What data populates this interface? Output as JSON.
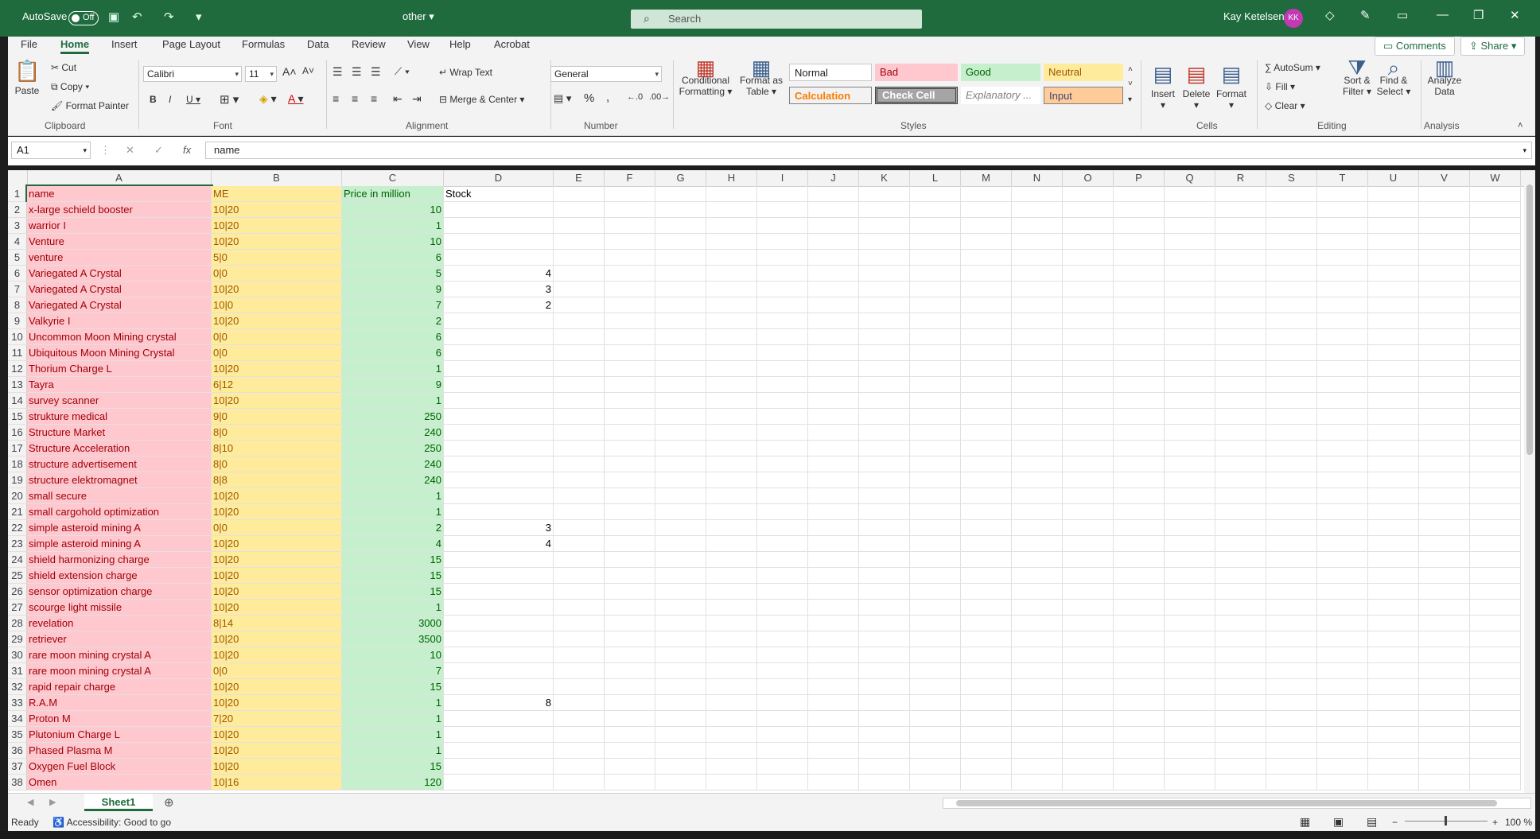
{
  "titlebar": {
    "autosave_label": "AutoSave",
    "autosave_state": "Off",
    "doc_title": "other",
    "search_placeholder": "Search",
    "user_name": "Kay Ketelsen",
    "user_initials": "KK"
  },
  "ribbon_tabs": [
    "File",
    "Home",
    "Insert",
    "Page Layout",
    "Formulas",
    "Data",
    "Review",
    "View",
    "Help",
    "Acrobat"
  ],
  "ribbon_buttons": {
    "comments": "Comments",
    "share": "Share"
  },
  "clipboard": {
    "paste": "Paste",
    "cut": "Cut",
    "copy": "Copy",
    "format_painter": "Format Painter",
    "group": "Clipboard"
  },
  "font": {
    "name": "Calibri",
    "size": "11",
    "group": "Font"
  },
  "alignment": {
    "wrap_text": "Wrap Text",
    "merge_center": "Merge & Center",
    "group": "Alignment"
  },
  "number": {
    "format": "General",
    "group": "Number"
  },
  "styles": {
    "conditional": "Conditional Formatting",
    "format_as_table": "Format as Table",
    "normal": "Normal",
    "bad": "Bad",
    "good": "Good",
    "neutral": "Neutral",
    "calculation": "Calculation",
    "check_cell": "Check Cell",
    "explanatory": "Explanatory ...",
    "input": "Input",
    "group": "Styles"
  },
  "cells": {
    "insert": "Insert",
    "delete": "Delete",
    "format": "Format",
    "group": "Cells"
  },
  "editing": {
    "autosum": "AutoSum",
    "fill": "Fill",
    "clear": "Clear",
    "sort_filter": "Sort & Filter",
    "find_select": "Find & Select",
    "group": "Editing"
  },
  "analysis": {
    "analyze_data": "Analyze Data",
    "group": "Analysis"
  },
  "formula_bar": {
    "name_box": "A1",
    "content": "name"
  },
  "columns": [
    "A",
    "B",
    "C",
    "D",
    "E",
    "F",
    "G",
    "H",
    "I",
    "J",
    "K",
    "L",
    "M",
    "N",
    "O",
    "P",
    "Q",
    "R",
    "S",
    "T",
    "U",
    "V",
    "W"
  ],
  "sheet_rows": [
    [
      "name",
      "ME",
      "Price in million",
      "Stock"
    ],
    [
      "x-large schield booster",
      "10|20",
      "10",
      ""
    ],
    [
      "warrior I",
      "10|20",
      "1",
      ""
    ],
    [
      "Venture",
      "10|20",
      "10",
      ""
    ],
    [
      "venture",
      "5|0",
      "6",
      ""
    ],
    [
      "Variegated A Crystal",
      "0|0",
      "5",
      "4"
    ],
    [
      "Variegated A Crystal",
      "10|20",
      "9",
      "3"
    ],
    [
      "Variegated A Crystal",
      "10|0",
      "7",
      "2"
    ],
    [
      "Valkyrie I",
      "10|20",
      "2",
      ""
    ],
    [
      "Uncommon Moon Mining crystal",
      "0|0",
      "6",
      ""
    ],
    [
      "Ubiquitous Moon Mining Crystal",
      "0|0",
      "6",
      ""
    ],
    [
      "Thorium Charge L",
      "10|20",
      "1",
      ""
    ],
    [
      "Tayra",
      "6|12",
      "9",
      ""
    ],
    [
      "survey scanner",
      "10|20",
      "1",
      ""
    ],
    [
      "strukture medical",
      "9|0",
      "250",
      ""
    ],
    [
      "Structure Market",
      "8|0",
      "240",
      ""
    ],
    [
      "Structure Acceleration",
      "8|10",
      "250",
      ""
    ],
    [
      "structure advertisement",
      "8|0",
      "240",
      ""
    ],
    [
      "structure elektromagnet",
      "8|8",
      "240",
      ""
    ],
    [
      "small secure",
      "10|20",
      "1",
      ""
    ],
    [
      "small cargohold optimization",
      "10|20",
      "1",
      ""
    ],
    [
      "simple asteroid mining A",
      "0|0",
      "2",
      "3"
    ],
    [
      "simple asteroid mining A",
      "10|20",
      "4",
      "4"
    ],
    [
      "shield harmonizing charge",
      "10|20",
      "15",
      ""
    ],
    [
      "shield extension charge",
      "10|20",
      "15",
      ""
    ],
    [
      "sensor optimization charge",
      "10|20",
      "15",
      ""
    ],
    [
      "scourge light missile",
      "10|20",
      "1",
      ""
    ],
    [
      "revelation",
      "8|14",
      "3000",
      ""
    ],
    [
      "retriever",
      "10|20",
      "3500",
      ""
    ],
    [
      "rare moon mining crystal A",
      "10|20",
      "10",
      ""
    ],
    [
      "rare moon mining crystal A",
      "0|0",
      "7",
      ""
    ],
    [
      "rapid repair charge",
      "10|20",
      "15",
      ""
    ],
    [
      "R.A.M",
      "10|20",
      "1",
      "8"
    ],
    [
      "Proton M",
      "7|20",
      "1",
      ""
    ],
    [
      "Plutonium Charge L",
      "10|20",
      "1",
      ""
    ],
    [
      "Phased Plasma M",
      "10|20",
      "1",
      ""
    ],
    [
      "Oxygen Fuel Block",
      "10|20",
      "15",
      ""
    ],
    [
      "Omen",
      "10|16",
      "120",
      ""
    ]
  ],
  "sheet_tab": "Sheet1",
  "status": {
    "ready": "Ready",
    "accessibility": "Accessibility: Good to go",
    "zoom": "100 %"
  }
}
